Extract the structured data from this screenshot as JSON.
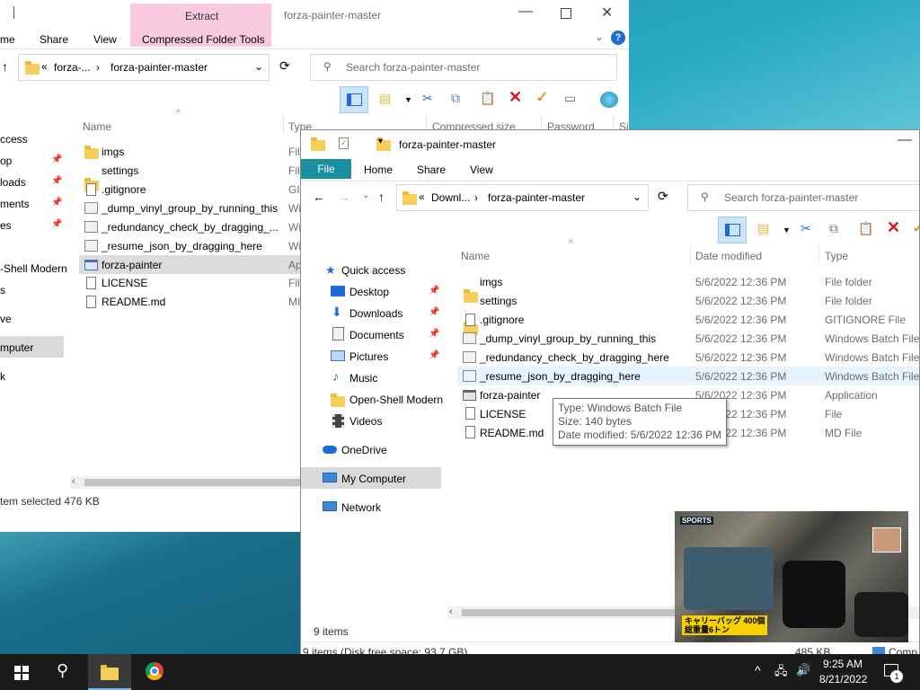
{
  "back_window": {
    "tab_extract": "Extract",
    "tab_compressed": "Compressed Folder Tools",
    "title": "forza-painter-master",
    "tab_home": "me",
    "tab_share": "Share",
    "tab_view": "View",
    "addr_prefix": "«",
    "addr_part1": "forza-...",
    "addr_part2": "forza-painter-master",
    "search_placeholder": "Search forza-painter-master",
    "col_name": "Name",
    "col_type": "Type",
    "col_compressed": "Compressed size",
    "col_password": "Password ...",
    "col_size": "Si",
    "nav": [
      "ccess",
      "op",
      "loads",
      "ments",
      "es",
      "-Shell Modern",
      "s",
      "ve",
      "mputer",
      "k"
    ],
    "files": [
      {
        "name": "imgs",
        "type": "Fil",
        "icon": "folder-icon"
      },
      {
        "name": "settings",
        "type": "Fil",
        "icon": "folder-icon"
      },
      {
        "name": ".gitignore",
        "type": "GIT",
        "icon": "file-icon"
      },
      {
        "name": "_dump_vinyl_group_by_running_this",
        "type": "Wi",
        "icon": "batch-file-icon"
      },
      {
        "name": "_redundancy_check_by_dragging_...",
        "type": "Wi",
        "icon": "batch-file-icon"
      },
      {
        "name": "_resume_json_by_dragging_here",
        "type": "Wi",
        "icon": "batch-file-icon"
      },
      {
        "name": "forza-painter",
        "type": "Ap",
        "icon": "application-icon"
      },
      {
        "name": "LICENSE",
        "type": "Fil",
        "icon": "file-icon"
      },
      {
        "name": "README.md",
        "type": "MI",
        "icon": "file-icon"
      }
    ],
    "status": "tem selected  476 KB"
  },
  "front_window": {
    "title": "forza-painter-master",
    "tab_file": "File",
    "tab_home": "Home",
    "tab_share": "Share",
    "tab_view": "View",
    "addr_prefix": "«",
    "addr_part1": "Downl...",
    "addr_part2": "forza-painter-master",
    "search_placeholder": "Search forza-painter-master",
    "col_name": "Name",
    "col_date": "Date modified",
    "col_type": "Type",
    "nav": [
      {
        "label": "Quick access",
        "icon": "star-icon"
      },
      {
        "label": "Desktop",
        "icon": "desktop-icon",
        "pinned": true
      },
      {
        "label": "Downloads",
        "icon": "download-icon",
        "pinned": true
      },
      {
        "label": "Documents",
        "icon": "documents-icon",
        "pinned": true
      },
      {
        "label": "Pictures",
        "icon": "pictures-icon",
        "pinned": true
      },
      {
        "label": "Music",
        "icon": "music-icon"
      },
      {
        "label": "Open-Shell Modern",
        "icon": "folder-icon"
      },
      {
        "label": "Videos",
        "icon": "videos-icon"
      },
      {
        "label": "OneDrive",
        "icon": "cloud-icon"
      },
      {
        "label": "My Computer",
        "icon": "computer-icon"
      },
      {
        "label": "Network",
        "icon": "network-icon"
      }
    ],
    "files": [
      {
        "name": "imgs",
        "date": "5/6/2022 12:36 PM",
        "type": "File folder",
        "icon": "folder-icon"
      },
      {
        "name": "settings",
        "date": "5/6/2022 12:36 PM",
        "type": "File folder",
        "icon": "folder-icon"
      },
      {
        "name": ".gitignore",
        "date": "5/6/2022 12:36 PM",
        "type": "GITIGNORE File",
        "icon": "file-icon"
      },
      {
        "name": "_dump_vinyl_group_by_running_this",
        "date": "5/6/2022 12:36 PM",
        "type": "Windows Batch File",
        "icon": "batch-file-icon"
      },
      {
        "name": "_redundancy_check_by_dragging_here",
        "date": "5/6/2022 12:36 PM",
        "type": "Windows Batch File",
        "icon": "batch-file-icon"
      },
      {
        "name": "_resume_json_by_dragging_here",
        "date": "5/6/2022 12:36 PM",
        "type": "Windows Batch File",
        "icon": "batch-file-icon"
      },
      {
        "name": "forza-painter",
        "date": "5/6/2022 12:36 PM",
        "type": "Application",
        "icon": "application-icon"
      },
      {
        "name": "LICENSE",
        "date": "5/6/2022 12:36 PM",
        "type": "File",
        "icon": "file-icon"
      },
      {
        "name": "README.md",
        "date": "5/6/2022 12:36 PM",
        "type": "MD File",
        "icon": "file-icon"
      }
    ],
    "tooltip": {
      "type": "Type: Windows Batch File",
      "size": "Size: 140 bytes",
      "date": "Date modified: 5/6/2022 12:36 PM"
    },
    "items_count": "9 items",
    "status_bar": "9 items (Disk free space: 93.7 GB)",
    "status_size": "485 KB",
    "status_comp": "Comp"
  },
  "video_overlay": {
    "sports_label": "SPORTS",
    "caption_line1": "キャリーバッグ 400個",
    "caption_line2": "総重量6トン"
  },
  "taskbar": {
    "time": "9:25 AM",
    "date": "8/21/2022",
    "notification_count": "1"
  }
}
